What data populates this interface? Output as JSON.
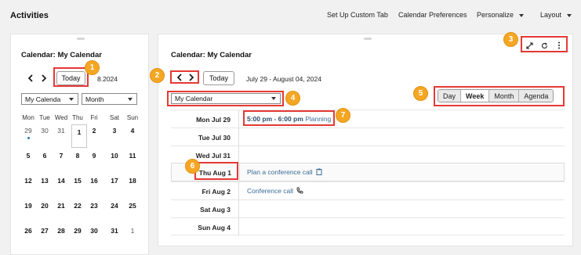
{
  "header": {
    "title": "Activities",
    "links": [
      "Set Up Custom Tab",
      "Calendar Preferences",
      "Personalize",
      "Layout"
    ]
  },
  "mini_calendar": {
    "title": "Calendar: My Calendar",
    "today_label": "Today",
    "month_label": "8.2024",
    "calendar_select": "My Calenda",
    "view_select": "Month",
    "weekdays": [
      "Mon",
      "Tue",
      "Wed",
      "Thu",
      "Fri",
      "Sat",
      "Sun"
    ],
    "weeks": [
      [
        "29",
        "30",
        "31",
        "1",
        "2",
        "3",
        "4"
      ],
      [
        "5",
        "6",
        "7",
        "8",
        "9",
        "10",
        "11"
      ],
      [
        "12",
        "13",
        "14",
        "15",
        "16",
        "17",
        "18"
      ],
      [
        "19",
        "20",
        "21",
        "22",
        "23",
        "24",
        "25"
      ],
      [
        "26",
        "27",
        "28",
        "29",
        "30",
        "31",
        "1"
      ]
    ]
  },
  "main": {
    "title": "Calendar: My Calendar",
    "today_label": "Today",
    "date_range": "July 29 - August 04, 2024",
    "calendar_select": "My Calendar",
    "views": [
      "Day",
      "Week",
      "Month",
      "Agenda"
    ],
    "active_view": "Week",
    "days": [
      {
        "label": "Mon Jul 29"
      },
      {
        "label": "Tue Jul 30"
      },
      {
        "label": "Wed Jul 31"
      },
      {
        "label": "Thu Aug 1"
      },
      {
        "label": "Fri Aug 2"
      },
      {
        "label": "Sat Aug 3"
      },
      {
        "label": "Sun Aug 4"
      }
    ],
    "events": {
      "e1_time": "5:00 pm - 6:00 pm",
      "e1_title": "Planning",
      "e2_title": "Plan a conference call",
      "e3_title": "Conference call"
    }
  },
  "callouts": [
    "1",
    "2",
    "3",
    "4",
    "5",
    "6",
    "7"
  ],
  "colors": {
    "callout_border": "#e53935",
    "badge": "#f5a623",
    "event_link": "#3a6c96"
  }
}
